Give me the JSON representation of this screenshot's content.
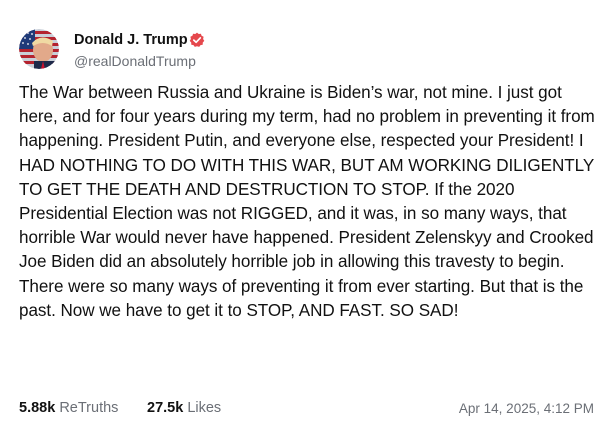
{
  "author": {
    "name": "Donald J. Trump",
    "handle": "@realDonaldTrump",
    "verified_icon": "verified-badge-icon",
    "avatar_icon": "profile-avatar-icon"
  },
  "post": {
    "text": "The War between Russia and Ukraine is Biden’s war, not mine. I just got here, and for four years during my term, had no problem in preventing it from happening. President Putin, and everyone else, respected your President! I HAD NOTHING TO DO WITH THIS WAR, BUT AM WORKING DILIGENTLY TO GET THE DEATH AND DESTRUCTION TO STOP. If the 2020 Presidential Election was not RIGGED, and it was, in so many ways, that horrible War would never have happened. President Zelenskyy and Crooked Joe Biden did an absolutely horrible job in allowing this travesty to begin. There were so many ways of preventing it from ever starting. But that is the past. Now we have to get it to STOP, AND FAST. SO SAD!"
  },
  "stats": {
    "retruths_count": "5.88k",
    "retruths_label": "ReTruths",
    "likes_count": "27.5k",
    "likes_label": "Likes"
  },
  "timestamp": "Apr 14, 2025, 4:12 PM",
  "colors": {
    "verified_badge": "#e5484d",
    "text_primary": "#111111",
    "text_secondary": "#6b6f76",
    "background": "#ffffff"
  }
}
